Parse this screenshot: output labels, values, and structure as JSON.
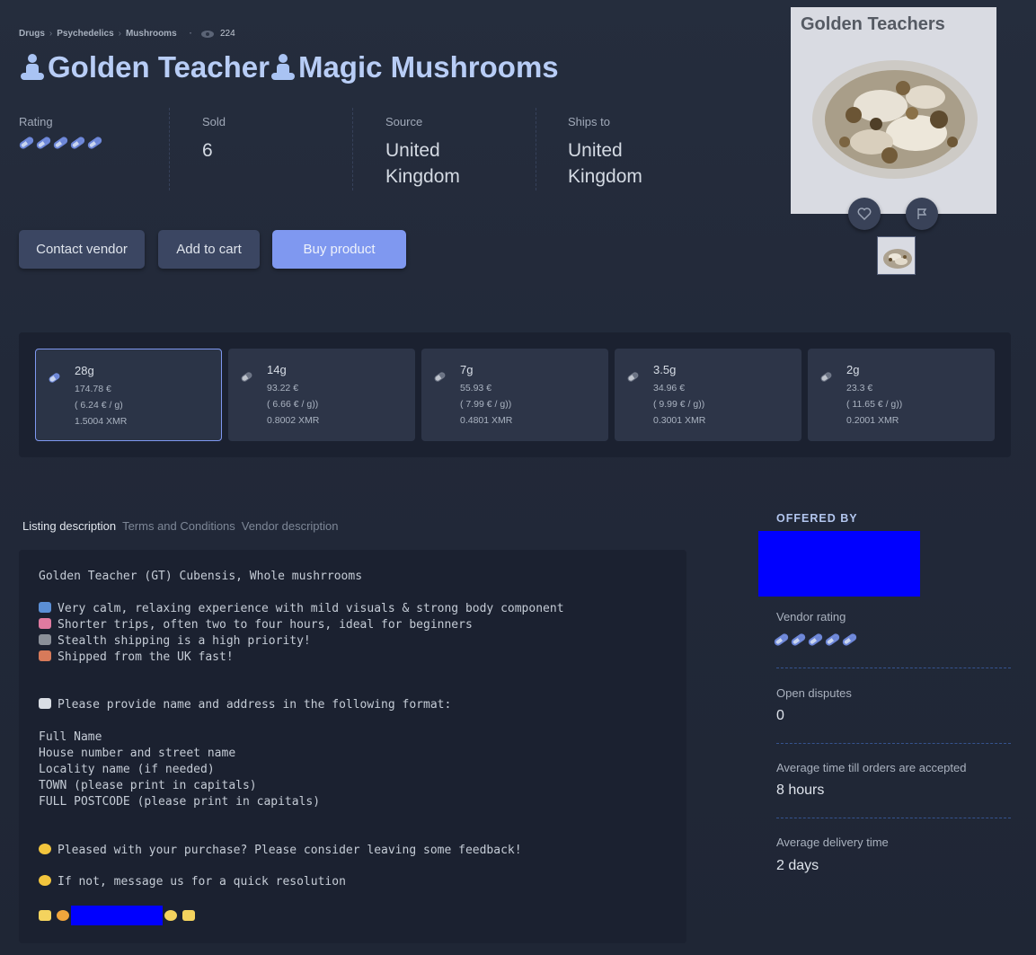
{
  "breadcrumb": {
    "items": [
      "Drugs",
      "Psychedelics",
      "Mushrooms"
    ],
    "views": "224"
  },
  "title": {
    "part1": "Golden Teacher",
    "part2": " Magic Mushrooms"
  },
  "stats": {
    "rating_label": "Rating",
    "rating_pills": 5,
    "sold_label": "Sold",
    "sold_value": "6",
    "source_label": "Source",
    "source_value": "United Kingdom",
    "ships_label": "Ships to",
    "ships_value": "United Kingdom"
  },
  "actions": {
    "contact": "Contact vendor",
    "cart": "Add to cart",
    "buy": "Buy product"
  },
  "image": {
    "caption": "Golden Teachers"
  },
  "variants": [
    {
      "name": "28g",
      "price": "174.78 €",
      "per_gram": "( 6.24 € / g)",
      "xmr": "1.5004 XMR",
      "selected": true
    },
    {
      "name": "14g",
      "price": "93.22 €",
      "per_gram": "( 6.66 € / g))",
      "xmr": "0.8002 XMR",
      "selected": false
    },
    {
      "name": "7g",
      "price": "55.93 €",
      "per_gram": "( 7.99 € / g))",
      "xmr": "0.4801 XMR",
      "selected": false
    },
    {
      "name": "3.5g",
      "price": "34.96 €",
      "per_gram": "( 9.99 € / g))",
      "xmr": "0.3001 XMR",
      "selected": false
    },
    {
      "name": "2g",
      "price": "23.3 €",
      "per_gram": "( 11.65 € / g))",
      "xmr": "0.2001 XMR",
      "selected": false
    }
  ],
  "tabs": [
    "Listing description",
    "Terms and Conditions",
    "Vendor description"
  ],
  "description": {
    "l1": "Golden Teacher (GT) Cubensis, Whole mushrrooms",
    "l2": "Very calm, relaxing experience with mild visuals & strong body component",
    "l3": "Shorter trips, often two to four hours, ideal for beginners",
    "l4": "Stealth shipping is a high priority!",
    "l5": "Shipped from the UK fast!",
    "l6": "Please provide name and address in the following format:",
    "l7": "Full Name",
    "l8": "House number and street name",
    "l9": "Locality name (if needed)",
    "l10": "TOWN (please print in capitals)",
    "l11": "FULL POSTCODE (please print in capitals)",
    "l12": "Pleased with your purchase? Please consider leaving some feedback!",
    "l13": "If not, message us for a quick resolution"
  },
  "vendor": {
    "offered_by": "OFFERED BY",
    "rating_label": "Vendor rating",
    "rating_pills": 5,
    "disputes_label": "Open disputes",
    "disputes_value": "0",
    "accept_label": "Average time till orders are accepted",
    "accept_value": "8 hours",
    "delivery_label": "Average delivery time",
    "delivery_value": "2 days"
  },
  "colors": {
    "accent": "#7f98f0",
    "title": "#b8cdf6",
    "redaction": "#0000ff"
  }
}
